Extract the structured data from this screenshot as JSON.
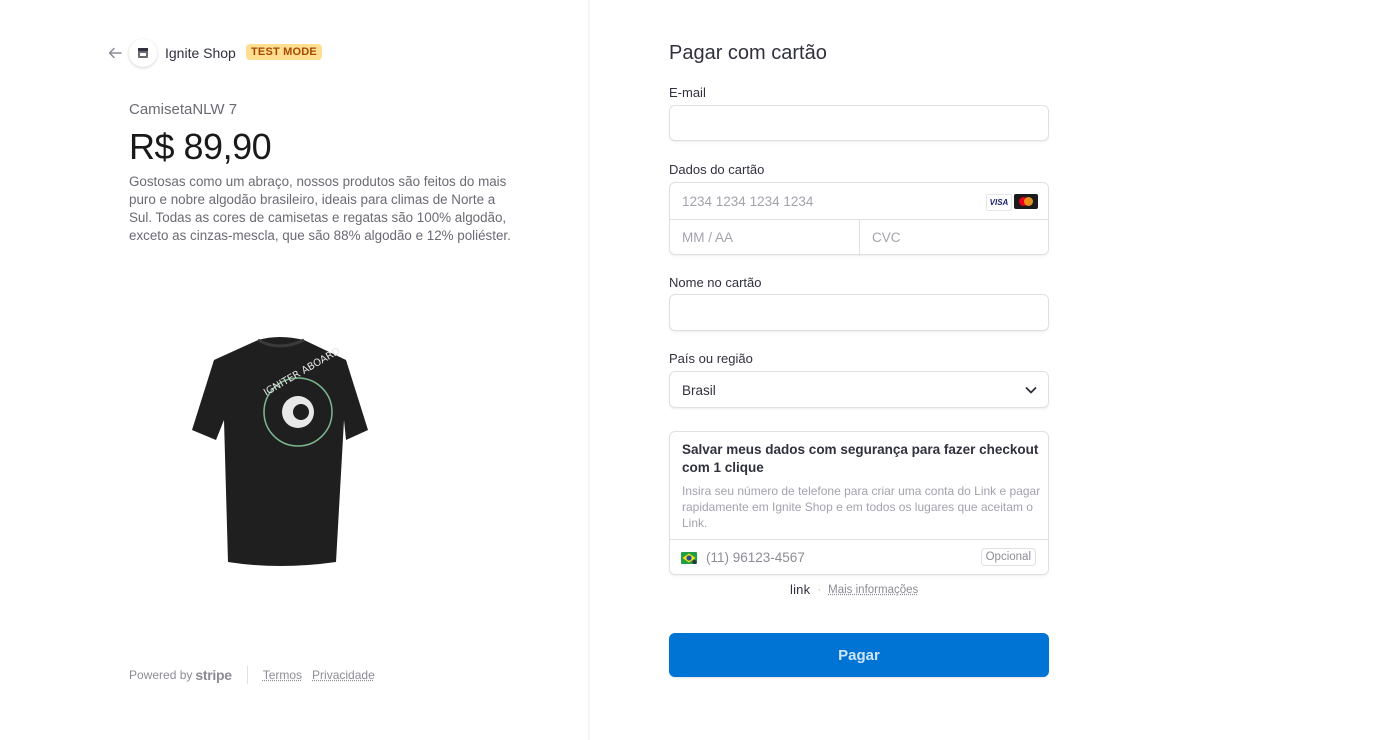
{
  "store": {
    "name": "Ignite Shop",
    "badge": "TEST MODE"
  },
  "product": {
    "name": "CamisetaNLW 7",
    "price": "R$ 89,90",
    "description": "Gostosas como um abraço, nossos produtos são feitos do mais puro e nobre algodão brasileiro, ideais para climas de Norte a Sul. Todas as cores de camisetas e regatas são 100% algodão, exceto as cinzas-mescla, que são 88% algodão e 12% poliéster.",
    "image_text": "IGNITER ABOARD"
  },
  "footer": {
    "powered_by": "Powered by",
    "brand": "stripe",
    "terms": "Termos",
    "privacy": "Privacidade"
  },
  "form": {
    "title": "Pagar com cartão",
    "email_label": "E-mail",
    "card_label": "Dados do cartão",
    "card_number_placeholder": "1234 1234 1234 1234",
    "expiry_placeholder": "MM / AA",
    "cvc_placeholder": "CVC",
    "card_brands": [
      "VISA",
      "mastercard"
    ],
    "name_label": "Nome no cartão",
    "country_label": "País ou região",
    "country_value": "Brasil",
    "link_title": "Salvar meus dados com segurança para fazer checkout com 1 clique",
    "link_description": "Insira seu número de telefone para criar uma conta do Link e pagar rapidamente em Ignite Shop e em todos os lugares que aceitam o Link.",
    "phone_placeholder": "(11) 96123-4567",
    "optional_label": "Opcional",
    "link_logo": "link",
    "more_info": "Mais informações",
    "pay_button": "Pagar"
  },
  "colors": {
    "accent": "#0074d4",
    "test_badge_bg": "#ffde92",
    "test_badge_text": "#a34a00"
  }
}
